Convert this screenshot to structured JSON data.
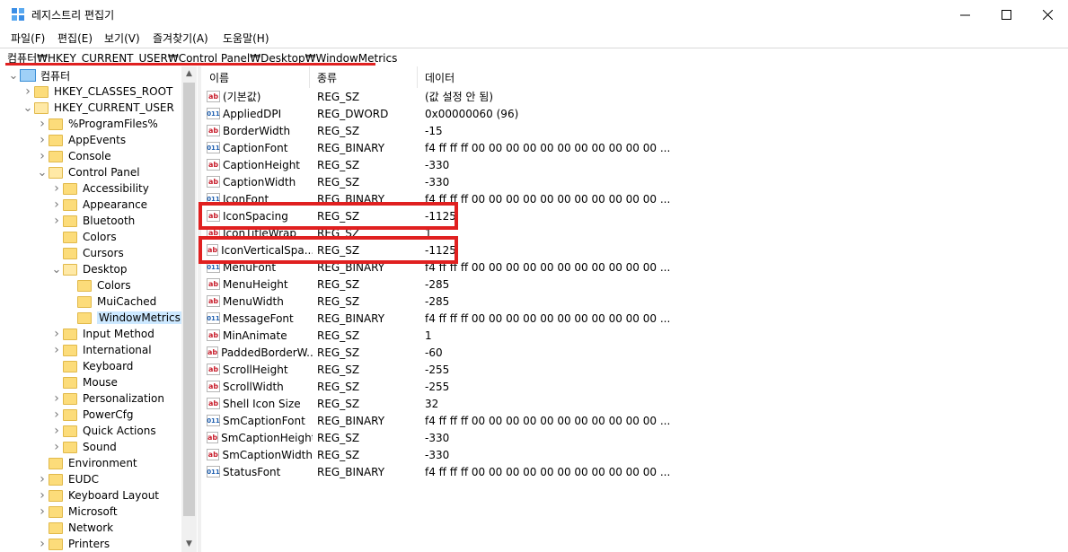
{
  "window": {
    "title": "레지스트리 편집기"
  },
  "menu": [
    "파일(F)",
    "편집(E)",
    "보기(V)",
    "즐겨찾기(A)",
    "도움말(H)"
  ],
  "address": "컴퓨터₩HKEY_CURRENT_USER₩Control Panel₩Desktop₩WindowMetrics",
  "tree": [
    {
      "label": "컴퓨터",
      "depth": 0,
      "chev": "open",
      "kind": "computer"
    },
    {
      "label": "HKEY_CLASSES_ROOT",
      "depth": 1,
      "chev": "closed"
    },
    {
      "label": "HKEY_CURRENT_USER",
      "depth": 1,
      "chev": "open"
    },
    {
      "label": "%ProgramFiles%",
      "depth": 2,
      "chev": "closed"
    },
    {
      "label": "AppEvents",
      "depth": 2,
      "chev": "closed"
    },
    {
      "label": "Console",
      "depth": 2,
      "chev": "closed"
    },
    {
      "label": "Control Panel",
      "depth": 2,
      "chev": "open"
    },
    {
      "label": "Accessibility",
      "depth": 3,
      "chev": "closed"
    },
    {
      "label": "Appearance",
      "depth": 3,
      "chev": "closed"
    },
    {
      "label": "Bluetooth",
      "depth": 3,
      "chev": "closed"
    },
    {
      "label": "Colors",
      "depth": 3,
      "chev": "none"
    },
    {
      "label": "Cursors",
      "depth": 3,
      "chev": "none"
    },
    {
      "label": "Desktop",
      "depth": 3,
      "chev": "open"
    },
    {
      "label": "Colors",
      "depth": 4,
      "chev": "none"
    },
    {
      "label": "MuiCached",
      "depth": 4,
      "chev": "none"
    },
    {
      "label": "WindowMetrics",
      "depth": 4,
      "chev": "none",
      "selected": true
    },
    {
      "label": "Input Method",
      "depth": 3,
      "chev": "closed"
    },
    {
      "label": "International",
      "depth": 3,
      "chev": "closed"
    },
    {
      "label": "Keyboard",
      "depth": 3,
      "chev": "none"
    },
    {
      "label": "Mouse",
      "depth": 3,
      "chev": "none"
    },
    {
      "label": "Personalization",
      "depth": 3,
      "chev": "closed"
    },
    {
      "label": "PowerCfg",
      "depth": 3,
      "chev": "closed"
    },
    {
      "label": "Quick Actions",
      "depth": 3,
      "chev": "closed"
    },
    {
      "label": "Sound",
      "depth": 3,
      "chev": "closed"
    },
    {
      "label": "Environment",
      "depth": 2,
      "chev": "none"
    },
    {
      "label": "EUDC",
      "depth": 2,
      "chev": "closed"
    },
    {
      "label": "Keyboard Layout",
      "depth": 2,
      "chev": "closed"
    },
    {
      "label": "Microsoft",
      "depth": 2,
      "chev": "closed"
    },
    {
      "label": "Network",
      "depth": 2,
      "chev": "none"
    },
    {
      "label": "Printers",
      "depth": 2,
      "chev": "closed"
    }
  ],
  "columns": [
    "이름",
    "종류",
    "데이터"
  ],
  "values": [
    {
      "name": "(기본값)",
      "type": "REG_SZ",
      "data": "(값 설정 안 됨)",
      "icon": "sz"
    },
    {
      "name": "AppliedDPI",
      "type": "REG_DWORD",
      "data": "0x00000060 (96)",
      "icon": "bin"
    },
    {
      "name": "BorderWidth",
      "type": "REG_SZ",
      "data": "-15",
      "icon": "sz"
    },
    {
      "name": "CaptionFont",
      "type": "REG_BINARY",
      "data": "f4 ff ff ff 00 00 00 00 00 00 00 00 00 00 00 ...",
      "icon": "bin"
    },
    {
      "name": "CaptionHeight",
      "type": "REG_SZ",
      "data": "-330",
      "icon": "sz"
    },
    {
      "name": "CaptionWidth",
      "type": "REG_SZ",
      "data": "-330",
      "icon": "sz"
    },
    {
      "name": "IconFont",
      "type": "REG_BINARY",
      "data": "f4 ff ff ff 00 00 00 00 00 00 00 00 00 00 00 ...",
      "icon": "bin"
    },
    {
      "name": "IconSpacing",
      "type": "REG_SZ",
      "data": "-1125",
      "icon": "sz",
      "highlight": true
    },
    {
      "name": "IconTitleWrap",
      "type": "REG_SZ",
      "data": "1",
      "icon": "sz"
    },
    {
      "name": "IconVerticalSpa...",
      "type": "REG_SZ",
      "data": "-1125",
      "icon": "sz",
      "highlight": true
    },
    {
      "name": "MenuFont",
      "type": "REG_BINARY",
      "data": "f4 ff ff ff 00 00 00 00 00 00 00 00 00 00 00 ...",
      "icon": "bin"
    },
    {
      "name": "MenuHeight",
      "type": "REG_SZ",
      "data": "-285",
      "icon": "sz"
    },
    {
      "name": "MenuWidth",
      "type": "REG_SZ",
      "data": "-285",
      "icon": "sz"
    },
    {
      "name": "MessageFont",
      "type": "REG_BINARY",
      "data": "f4 ff ff ff 00 00 00 00 00 00 00 00 00 00 00 ...",
      "icon": "bin"
    },
    {
      "name": "MinAnimate",
      "type": "REG_SZ",
      "data": "1",
      "icon": "sz"
    },
    {
      "name": "PaddedBorderW...",
      "type": "REG_SZ",
      "data": "-60",
      "icon": "sz"
    },
    {
      "name": "ScrollHeight",
      "type": "REG_SZ",
      "data": "-255",
      "icon": "sz"
    },
    {
      "name": "ScrollWidth",
      "type": "REG_SZ",
      "data": "-255",
      "icon": "sz"
    },
    {
      "name": "Shell Icon Size",
      "type": "REG_SZ",
      "data": "32",
      "icon": "sz"
    },
    {
      "name": "SmCaptionFont",
      "type": "REG_BINARY",
      "data": "f4 ff ff ff 00 00 00 00 00 00 00 00 00 00 00 ...",
      "icon": "bin"
    },
    {
      "name": "SmCaptionHeight",
      "type": "REG_SZ",
      "data": "-330",
      "icon": "sz"
    },
    {
      "name": "SmCaptionWidth",
      "type": "REG_SZ",
      "data": "-330",
      "icon": "sz"
    },
    {
      "name": "StatusFont",
      "type": "REG_BINARY",
      "data": "f4 ff ff ff 00 00 00 00 00 00 00 00 00 00 00 ...",
      "icon": "bin"
    }
  ],
  "icons": {
    "sz": "ab",
    "bin": "011"
  },
  "colors": {
    "highlight": "#e02020",
    "selection": "#cce8ff"
  }
}
